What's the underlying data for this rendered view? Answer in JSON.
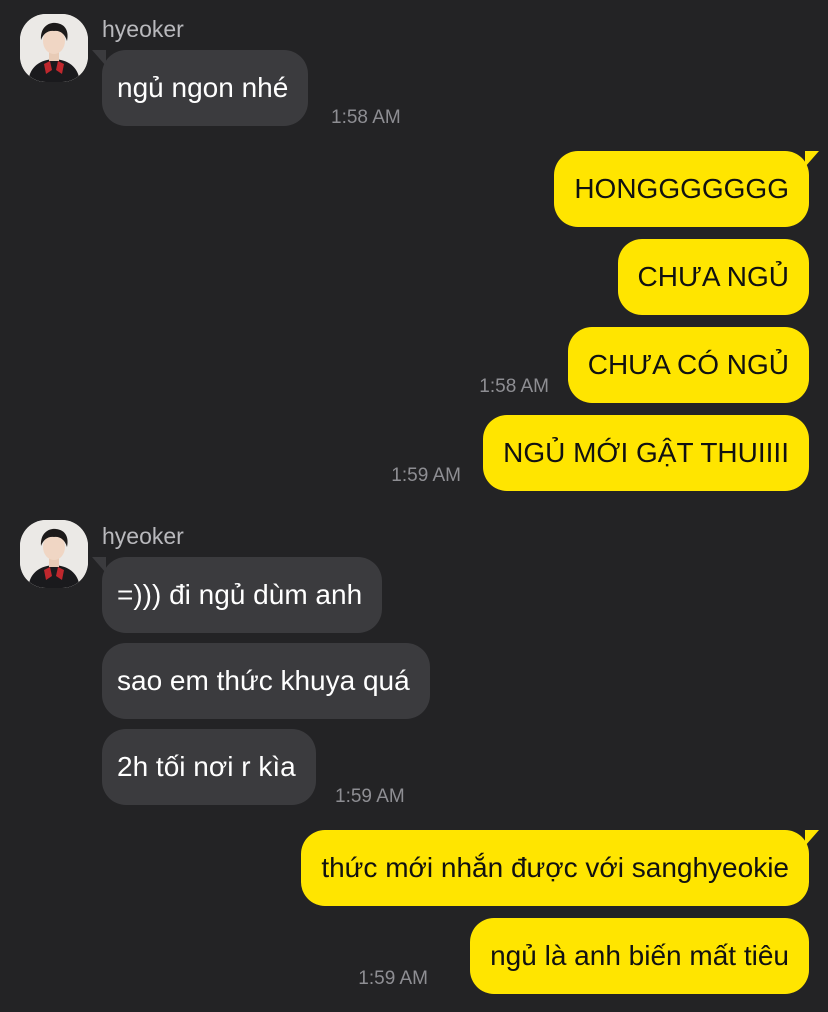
{
  "theme": {
    "background": "#232325",
    "incoming_bubble": "#3b3b3e",
    "outgoing_bubble": "#ffe500",
    "timestamp_color": "#8e8e93"
  },
  "groups": [
    {
      "sender": "hyeoker",
      "avatar_icon": "profile-photo-icon",
      "messages": [
        "ngủ ngon nhé"
      ],
      "time": "1:58 AM"
    },
    {
      "direction": "outgoing",
      "messages": [
        "HONGGGGGGG",
        "CHƯA NGỦ",
        "CHƯA CÓ NGỦ"
      ],
      "time": "1:58 AM"
    },
    {
      "direction": "outgoing",
      "messages": [
        "NGỦ MỚI GẬT THUIIII"
      ],
      "time": "1:59 AM"
    },
    {
      "sender": "hyeoker",
      "avatar_icon": "profile-photo-icon",
      "messages": [
        "=))) đi ngủ dùm anh",
        "sao em thức khuya quá",
        "2h tối nơi r kìa"
      ],
      "time": "1:59 AM"
    },
    {
      "direction": "outgoing",
      "messages": [
        "thức mới nhắn được với sanghyeokie",
        "ngủ là anh biến mất tiêu"
      ],
      "time": "1:59 AM"
    }
  ]
}
